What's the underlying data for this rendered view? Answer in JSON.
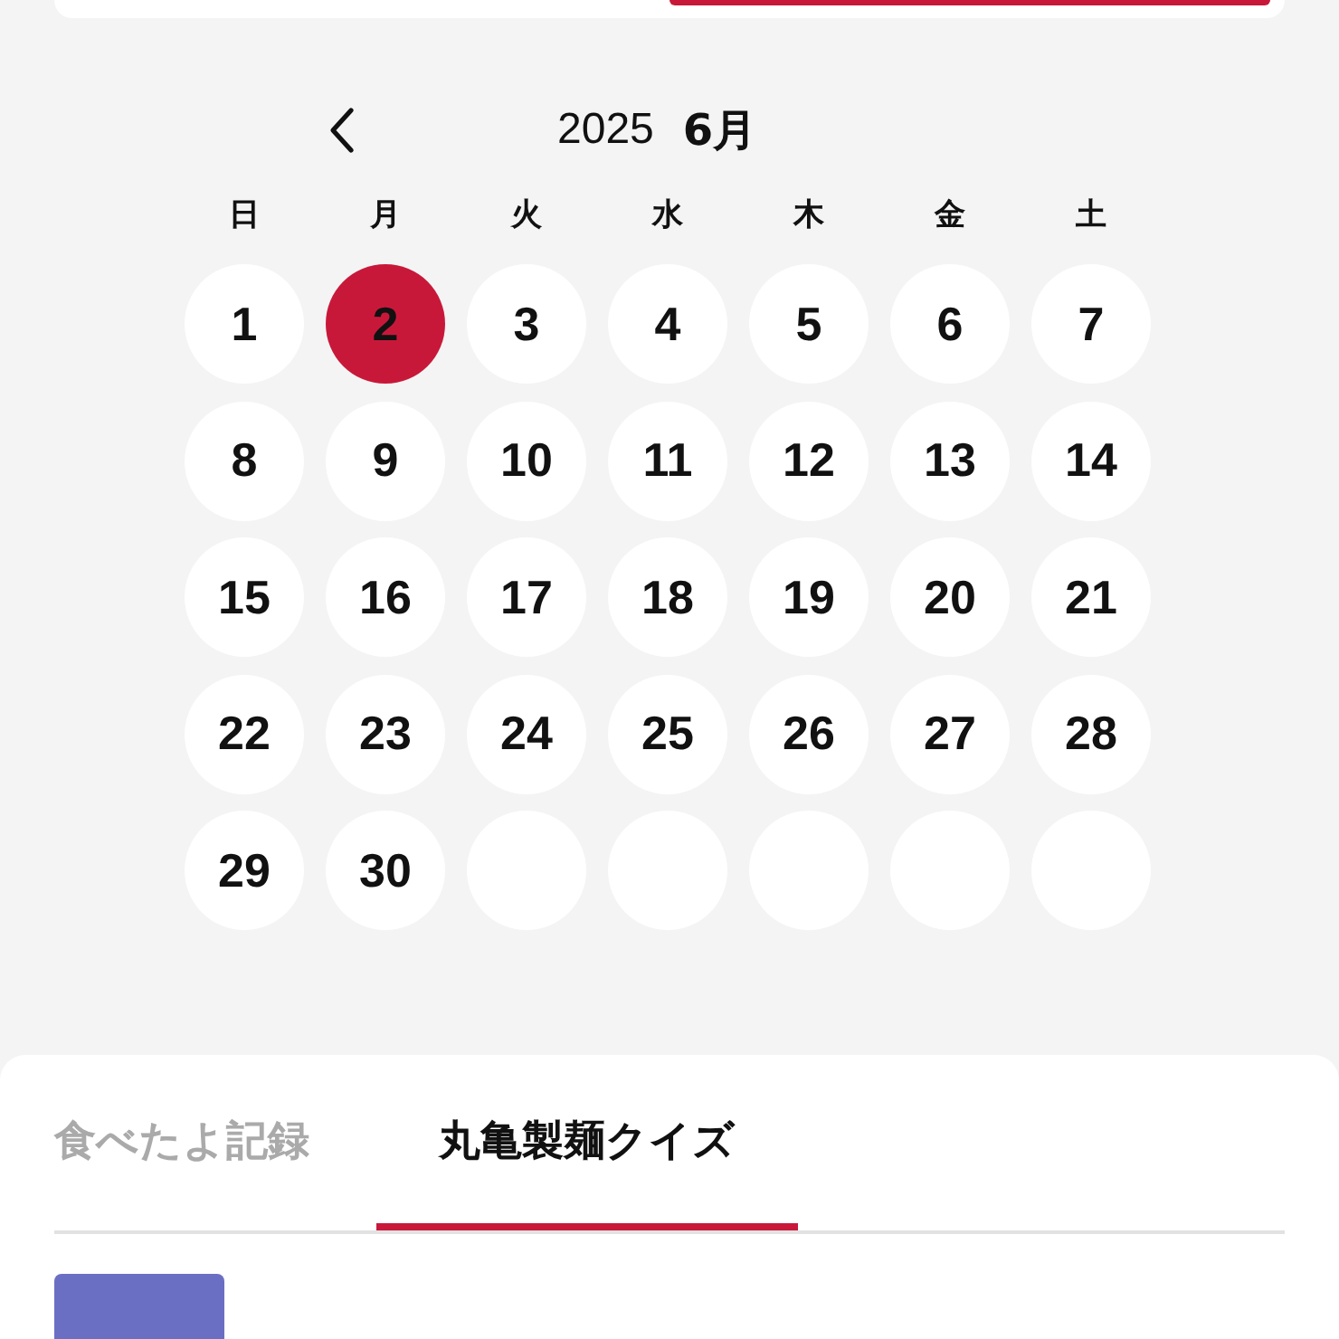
{
  "top_segments": [
    {
      "selected": false
    },
    {
      "selected": true
    }
  ],
  "calendar": {
    "year": "2025",
    "month": "6月",
    "weekdays": [
      "日",
      "月",
      "火",
      "水",
      "木",
      "金",
      "土"
    ],
    "days": [
      {
        "kind": "day",
        "label": "1",
        "selected": false
      },
      {
        "kind": "day",
        "label": "2",
        "selected": true
      },
      {
        "kind": "day",
        "label": "3",
        "selected": false
      },
      {
        "kind": "day",
        "label": "4",
        "selected": false
      },
      {
        "kind": "day",
        "label": "5",
        "selected": false
      },
      {
        "kind": "day",
        "label": "6",
        "selected": false
      },
      {
        "kind": "day",
        "label": "7",
        "selected": false
      },
      {
        "kind": "day",
        "label": "8",
        "selected": false
      },
      {
        "kind": "day",
        "label": "9",
        "selected": false
      },
      {
        "kind": "day",
        "label": "10",
        "selected": false
      },
      {
        "kind": "day",
        "label": "11",
        "selected": false
      },
      {
        "kind": "day",
        "label": "12",
        "selected": false
      },
      {
        "kind": "day",
        "label": "13",
        "selected": false
      },
      {
        "kind": "day",
        "label": "14",
        "selected": false
      },
      {
        "kind": "day",
        "label": "15",
        "selected": false
      },
      {
        "kind": "day",
        "label": "16",
        "selected": false
      },
      {
        "kind": "day",
        "label": "17",
        "selected": false
      },
      {
        "kind": "day",
        "label": "18",
        "selected": false
      },
      {
        "kind": "day",
        "label": "19",
        "selected": false
      },
      {
        "kind": "day",
        "label": "20",
        "selected": false
      },
      {
        "kind": "day",
        "label": "21",
        "selected": false
      },
      {
        "kind": "day",
        "label": "22",
        "selected": false
      },
      {
        "kind": "day",
        "label": "23",
        "selected": false
      },
      {
        "kind": "day",
        "label": "24",
        "selected": false
      },
      {
        "kind": "day",
        "label": "25",
        "selected": false
      },
      {
        "kind": "day",
        "label": "26",
        "selected": false
      },
      {
        "kind": "day",
        "label": "27",
        "selected": false
      },
      {
        "kind": "day",
        "label": "28",
        "selected": false
      },
      {
        "kind": "day",
        "label": "29",
        "selected": false
      },
      {
        "kind": "day",
        "label": "30",
        "selected": false
      },
      {
        "kind": "blank"
      },
      {
        "kind": "blank"
      },
      {
        "kind": "blank"
      },
      {
        "kind": "blank"
      },
      {
        "kind": "blank"
      }
    ]
  },
  "tabs": [
    {
      "label": "食べたよ記録",
      "selected": false
    },
    {
      "label": "丸亀製麺クイズ",
      "selected": true
    }
  ],
  "entries": [
    {
      "kind": "badge"
    }
  ]
}
